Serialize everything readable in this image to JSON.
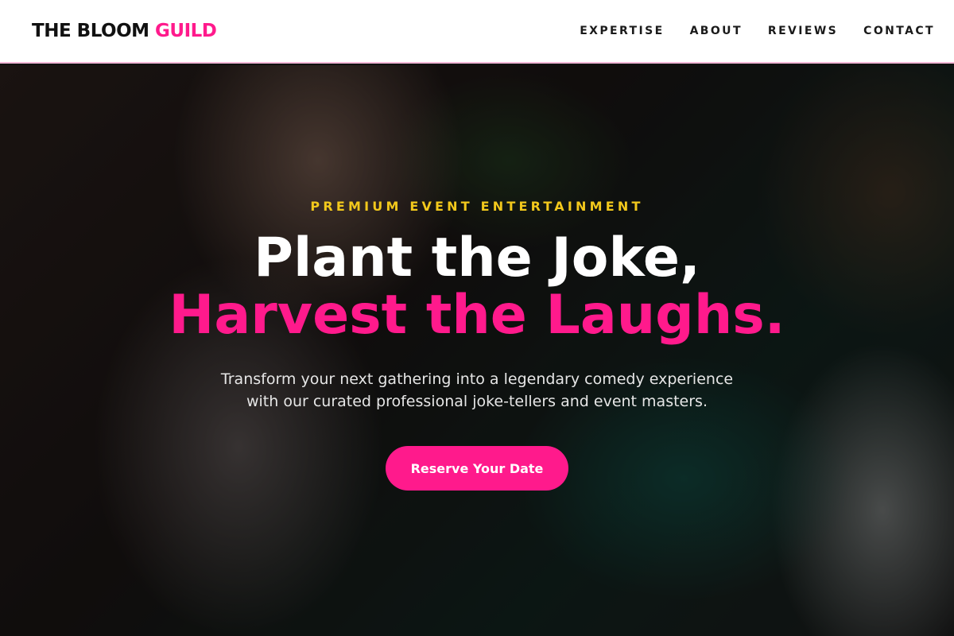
{
  "header": {
    "logo_main": "THE BLOOM ",
    "logo_accent": "GUILD",
    "nav": [
      {
        "label": "EXPERTISE"
      },
      {
        "label": "ABOUT"
      },
      {
        "label": "REVIEWS"
      },
      {
        "label": "CONTACT"
      }
    ]
  },
  "hero": {
    "eyebrow": "PREMIUM EVENT ENTERTAINMENT",
    "headline_line1": "Plant the Joke,",
    "headline_line2": "Harvest the Laughs.",
    "subtext": "Transform your next gathering into a legendary comedy experience with our curated professional joke-tellers and event masters.",
    "cta_label": "Reserve Your Date"
  },
  "colors": {
    "accent_pink": "#ff1a8c",
    "eyebrow_yellow": "#f2c81c"
  }
}
